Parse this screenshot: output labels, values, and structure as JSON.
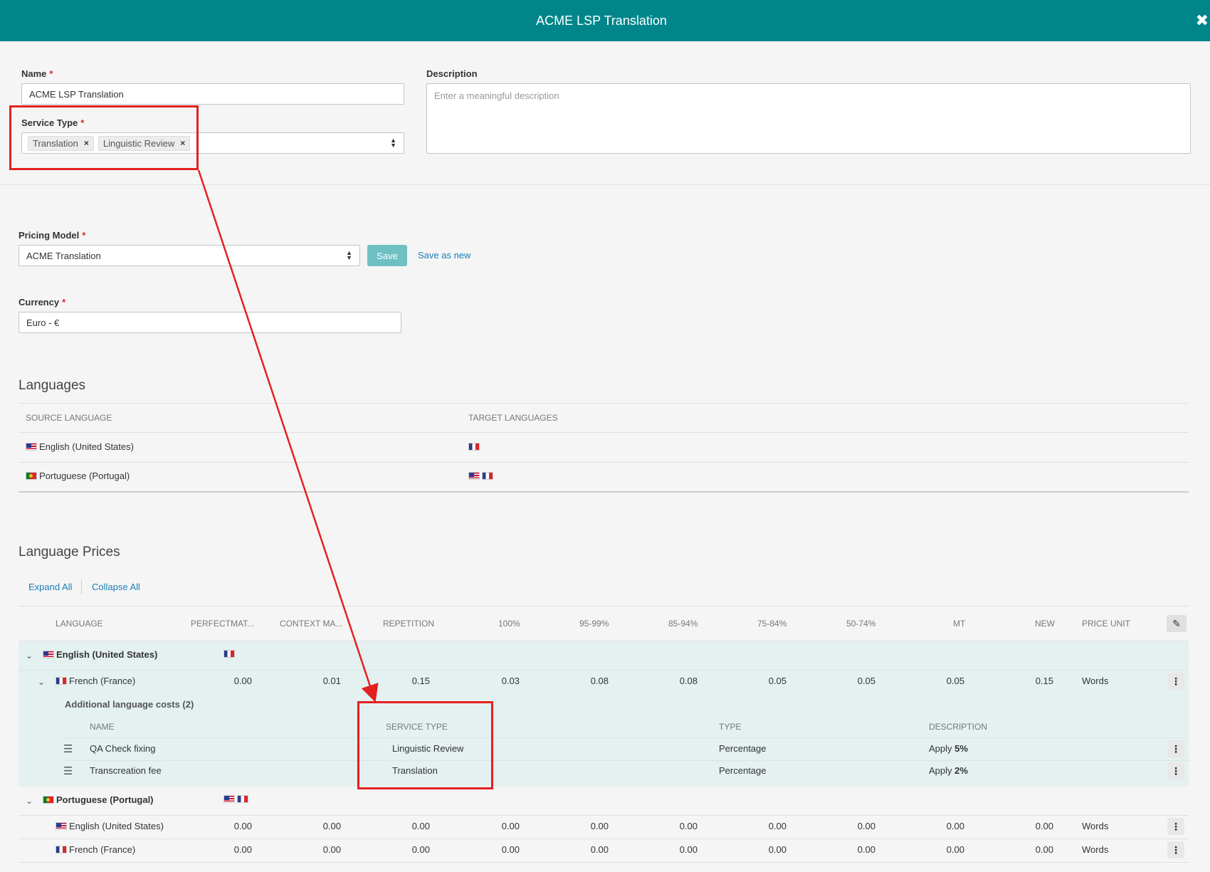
{
  "window": {
    "title": "ACME LSP Translation",
    "close_glyph": "✖"
  },
  "form": {
    "name": {
      "label": "Name",
      "required": "*",
      "value": "ACME LSP Translation"
    },
    "service_type": {
      "label": "Service Type",
      "required": "*",
      "chips": [
        "Translation",
        "Linguistic Review"
      ],
      "remove_glyph": "×"
    },
    "description": {
      "label": "Description",
      "placeholder": "Enter a meaningful description"
    },
    "pricing_model": {
      "label": "Pricing Model",
      "required": "*",
      "value": "ACME Translation",
      "save_label": "Save",
      "save_as_new_label": "Save as new"
    },
    "currency": {
      "label": "Currency",
      "required": "*",
      "value": "Euro - €"
    }
  },
  "languages": {
    "title": "Languages",
    "headers": {
      "source": "SOURCE LANGUAGE",
      "target": "TARGET LANGUAGES"
    },
    "rows": [
      {
        "source": "English (United States)",
        "source_flag": "us-flag",
        "targets": [
          "fr-flag"
        ]
      },
      {
        "source": "Portuguese (Portugal)",
        "source_flag": "pt-flag",
        "targets": [
          "us-flag",
          "fr-flag"
        ]
      }
    ]
  },
  "language_prices": {
    "title": "Language Prices",
    "expand_all": "Expand All",
    "collapse_all": "Collapse All",
    "headers": [
      "LANGUAGE",
      "PERFECTMAT...",
      "CONTEXT MA...",
      "REPETITION",
      "100%",
      "95-99%",
      "85-94%",
      "75-84%",
      "50-74%",
      "MT",
      "NEW",
      "PRICE UNIT"
    ],
    "groups": [
      {
        "source": "English (United States)",
        "rows": [
          {
            "lang": "French (France)",
            "values": [
              "0.00",
              "0.01",
              "0.15",
              "0.03",
              "0.08",
              "0.08",
              "0.05",
              "0.05",
              "0.05",
              "0.15"
            ],
            "unit": "Words"
          }
        ],
        "additional": {
          "title": "Additional language costs (2)",
          "headers": {
            "name": "NAME",
            "service_type": "SERVICE TYPE",
            "type": "TYPE",
            "description": "DESCRIPTION"
          },
          "rows": [
            {
              "name": "QA Check fixing",
              "service_type": "Linguistic Review",
              "type": "Percentage",
              "desc_prefix": "Apply",
              "desc_value": "5%"
            },
            {
              "name": "Transcreation fee",
              "service_type": "Translation",
              "type": "Percentage",
              "desc_prefix": "Apply",
              "desc_value": "2%"
            }
          ]
        }
      },
      {
        "source": "Portuguese (Portugal)",
        "rows": [
          {
            "lang": "English (United States)",
            "values": [
              "0.00",
              "0.00",
              "0.00",
              "0.00",
              "0.00",
              "0.00",
              "0.00",
              "0.00",
              "0.00",
              "0.00"
            ],
            "unit": "Words"
          },
          {
            "lang": "French (France)",
            "values": [
              "0.00",
              "0.00",
              "0.00",
              "0.00",
              "0.00",
              "0.00",
              "0.00",
              "0.00",
              "0.00",
              "0.00"
            ],
            "unit": "Words"
          }
        ]
      }
    ]
  },
  "annotation": {
    "color": "#e32121"
  }
}
